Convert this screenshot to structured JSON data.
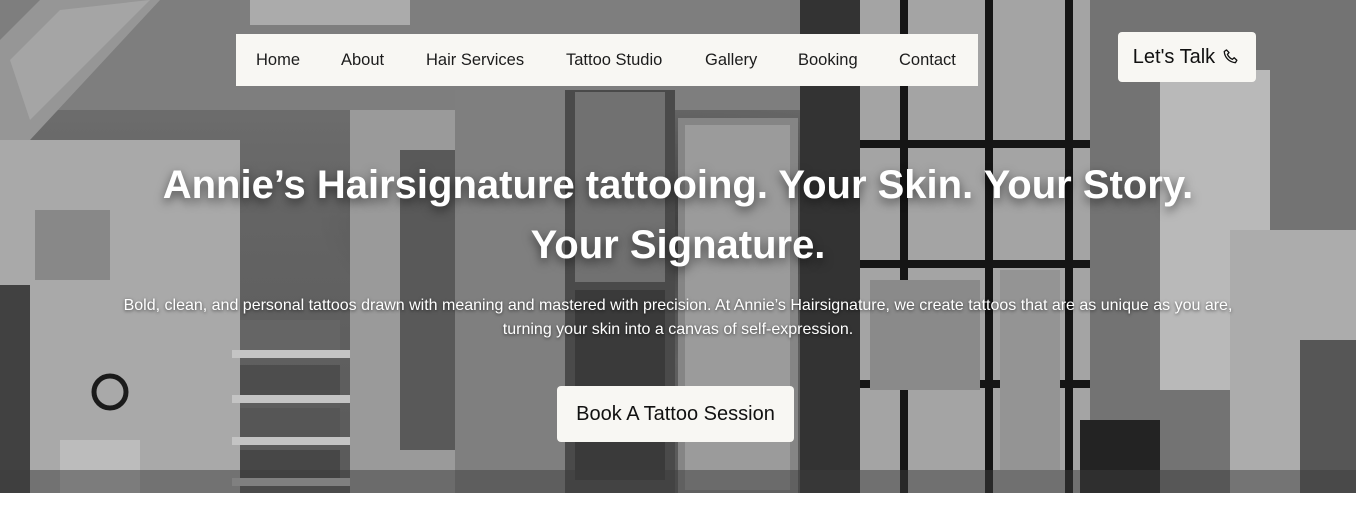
{
  "nav": {
    "items": [
      {
        "label": "Home"
      },
      {
        "label": "About"
      },
      {
        "label": "Hair Services"
      },
      {
        "label": "Tattoo Studio"
      },
      {
        "label": "Gallery"
      },
      {
        "label": "Booking"
      },
      {
        "label": "Contact"
      }
    ]
  },
  "cta_top": {
    "label": "Let's Talk",
    "icon": "phone-icon"
  },
  "hero": {
    "headline_line1": "Annie’s Hairsignature tattooing. Your Skin. Your Story.",
    "headline_line2": "Your Signature.",
    "subtext_line1": "Bold, clean, and personal tattoos drawn with meaning and mastered with precision. At Annie’s Hairsignature, we create tattoos that are as unique as you are,",
    "subtext_line2": "turning your skin into a canvas of self-expression.",
    "button_label": "Book A Tattoo Session",
    "background": "grayscale salon interior photo"
  },
  "colors": {
    "pill_bg": "#f8f7f3",
    "text_dark": "#1c1c1c",
    "hero_text": "#ffffff"
  }
}
